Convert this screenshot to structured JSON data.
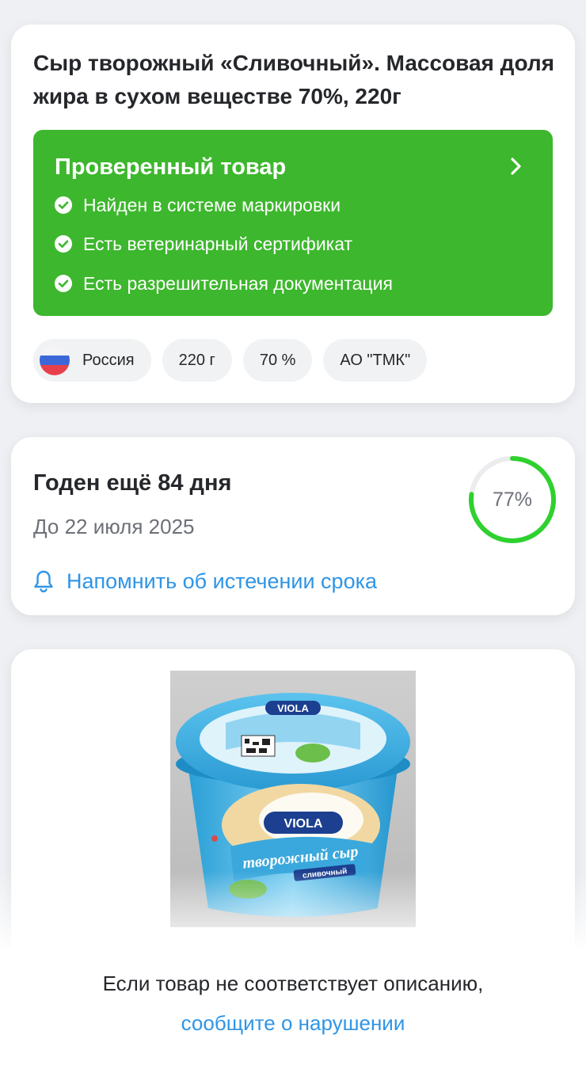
{
  "product": {
    "title": "Сыр творожный «Сливочный». Массовая доля жира в сухом веществе 70%, 220г"
  },
  "verified": {
    "title": "Проверенный товар",
    "items": [
      "Найден в системе маркировки",
      "Есть ветеринарный сертификат",
      "Есть разрешительная документация"
    ],
    "color": "#3db72d"
  },
  "chips": {
    "country": "Россия",
    "weight": "220 г",
    "fat": "70 %",
    "producer": "АО \"ТМК\""
  },
  "expiry": {
    "title": "Годен ещё 84 дня",
    "date": "До 22 июля 2025",
    "progress_label": "77%",
    "progress_fraction": 0.77,
    "progress_color": "#2fd12f",
    "remind_label": "Напомнить об истечении срока"
  },
  "photo": {
    "brand": "VIOLA",
    "name": "творожный сыр",
    "variant": "сливочный"
  },
  "report": {
    "text": "Если товар не соответствует описанию,",
    "link": "сообщите о нарушении"
  }
}
